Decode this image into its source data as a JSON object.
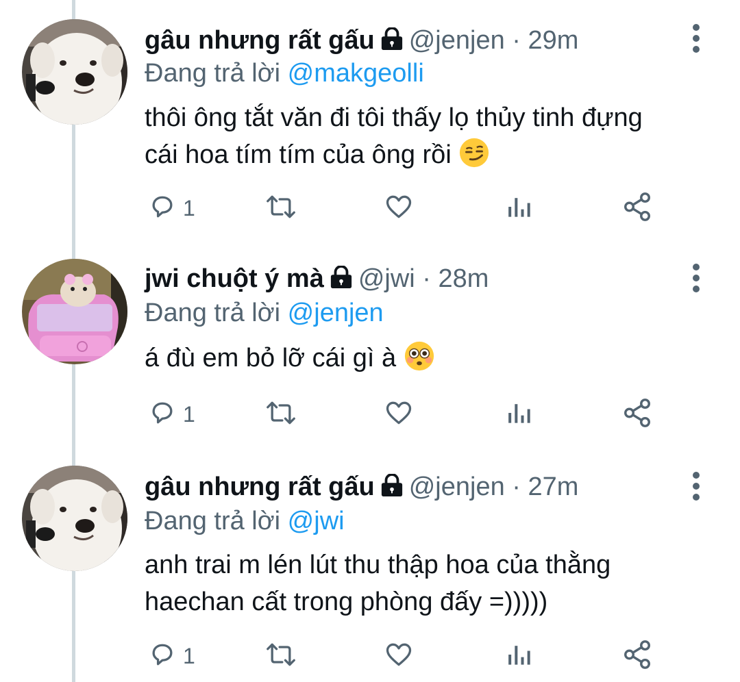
{
  "tweets": [
    {
      "display_name": "gâu nhưng rất gấu",
      "handle": "@jenjen",
      "time": "· 29m",
      "replying_prefix": "Đang trả lời ",
      "replying_to": "@makgeolli",
      "text_lines": [
        "thôi ông tắt văn đi tôi thấy lọ thủy tinh đựng",
        "cái hoa tím tím của ông rồi"
      ],
      "emoji": "smirking-face",
      "avatar": "white-dog-avatar",
      "reply_count": "1"
    },
    {
      "display_name": "jwi chuột ý mà",
      "handle": "@jwi",
      "time": "· 28m",
      "replying_prefix": "Đang trả lời ",
      "replying_to": "@jenjen",
      "text_lines": [
        "á đù em bỏ lỡ cái gì à"
      ],
      "emoji": "flushed-face",
      "avatar": "hamster-pink-car-avatar",
      "reply_count": "1"
    },
    {
      "display_name": "gâu nhưng rất gấu",
      "handle": "@jenjen",
      "time": "· 27m",
      "replying_prefix": "Đang trả lời ",
      "replying_to": "@jwi",
      "text_lines": [
        "anh trai m lén lút thu thập hoa của thằng",
        "haechan cất trong phòng đấy =)))))"
      ],
      "emoji": "",
      "avatar": "white-dog-avatar",
      "reply_count": "1"
    }
  ],
  "colors": {
    "name": "#0f1419",
    "meta": "#536471",
    "link": "#1d9bf0",
    "thread_line": "#cfd9de"
  },
  "icons": [
    "reply-icon",
    "retweet-icon",
    "like-icon",
    "analytics-icon",
    "share-icon",
    "lock-icon",
    "more-options-icon"
  ]
}
